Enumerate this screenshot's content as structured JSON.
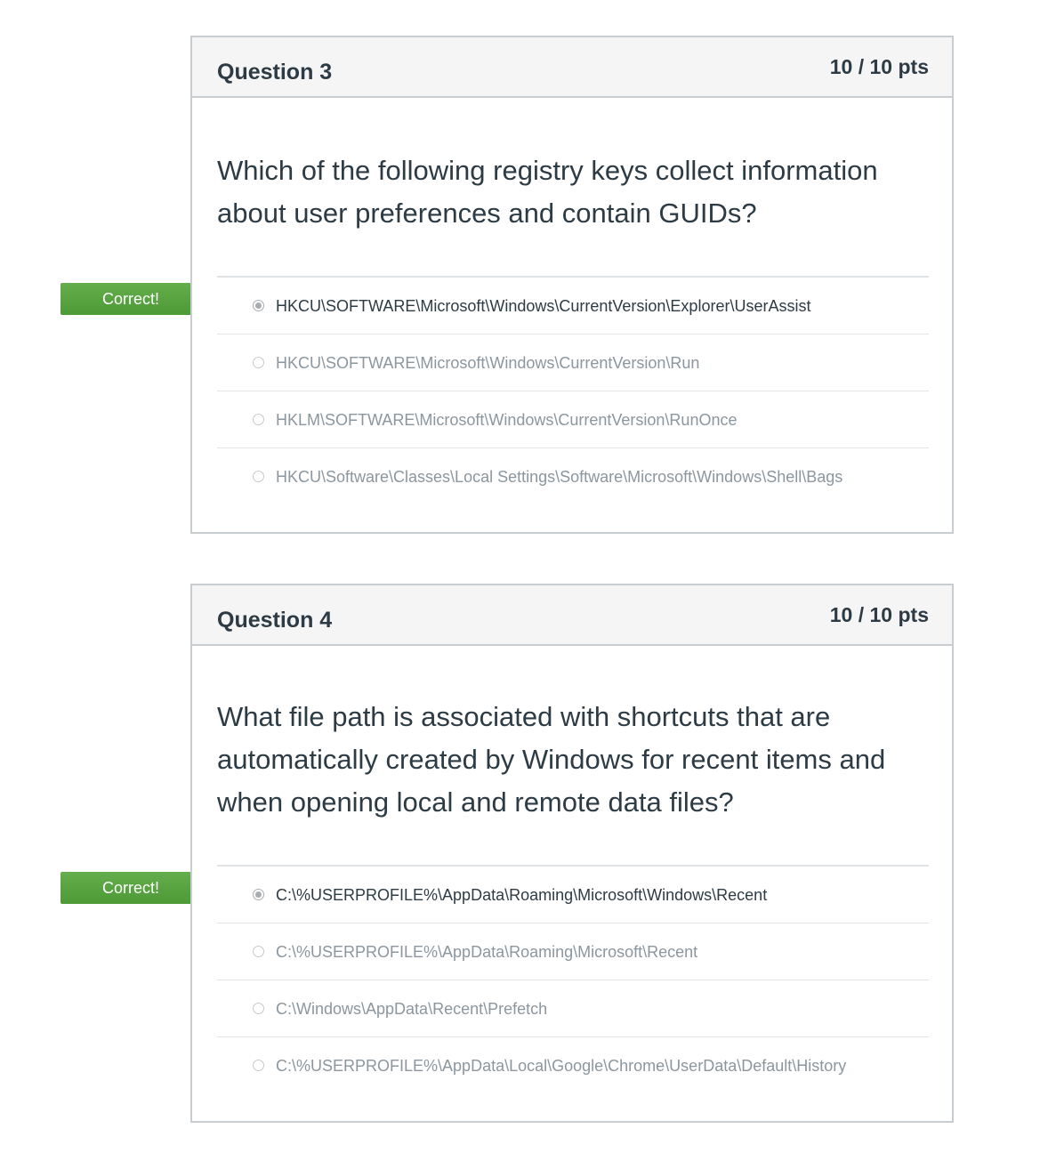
{
  "questions": [
    {
      "title": "Question 3",
      "points": "10 / 10 pts",
      "text": "Which of the following registry keys collect information about user preferences and contain GUIDs?",
      "result_label": "Correct!",
      "answers": [
        {
          "text": "HKCU\\SOFTWARE\\Microsoft\\Windows\\CurrentVersion\\Explorer\\UserAssist",
          "selected": true
        },
        {
          "text": "HKCU\\SOFTWARE\\Microsoft\\Windows\\CurrentVersion\\Run",
          "selected": false
        },
        {
          "text": "HKLM\\SOFTWARE\\Microsoft\\Windows\\CurrentVersion\\RunOnce",
          "selected": false
        },
        {
          "text": "HKCU\\Software\\Classes\\Local Settings\\Software\\Microsoft\\Windows\\Shell\\Bags",
          "selected": false
        }
      ]
    },
    {
      "title": "Question 4",
      "points": "10 / 10 pts",
      "text": "What file path is associated with shortcuts that are automatically created by Windows for recent items and when opening local and remote data files?",
      "result_label": "Correct!",
      "answers": [
        {
          "text": "C:\\%USERPROFILE%\\AppData\\Roaming\\Microsoft\\Windows\\Recent",
          "selected": true
        },
        {
          "text": "C:\\%USERPROFILE%\\AppData\\Roaming\\Microsoft\\Recent",
          "selected": false
        },
        {
          "text": "C:\\Windows\\AppData\\Recent\\Prefetch",
          "selected": false
        },
        {
          "text": "C:\\%USERPROFILE%\\AppData\\Local\\Google\\Chrome\\UserData\\Default\\History",
          "selected": false
        }
      ]
    }
  ],
  "colors": {
    "correct_flag": "#5aa543",
    "text": "#2d3b45",
    "muted_text": "#8b969e",
    "border": "#c7cdd1",
    "header_bg": "#f5f5f5"
  }
}
